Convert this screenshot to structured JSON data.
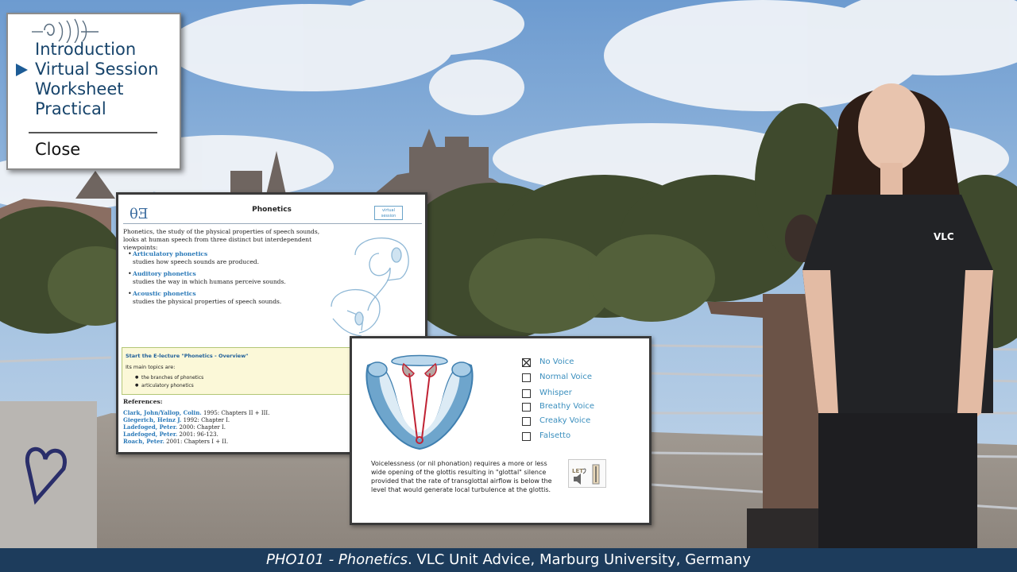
{
  "menu": {
    "items": [
      {
        "label": "Introduction",
        "active": false
      },
      {
        "label": "Virtual Session",
        "active": true
      },
      {
        "label": "Worksheet",
        "active": false
      },
      {
        "label": "Practical",
        "active": false
      }
    ],
    "close_label": "Close",
    "logo_icon": "sound-wave-logo-icon"
  },
  "doc": {
    "logo": "θƎ",
    "title": "Phonetics",
    "badge": "virtual session",
    "intro": "Phonetics, the study of the physical properties of speech sounds, looks at human speech from three distinct but interdependent viewpoints:",
    "branches": [
      {
        "name": "Articulatory phonetics",
        "desc": "studies how speech sounds are produced."
      },
      {
        "name": "Auditory phonetics",
        "desc": "studies the way in which humans perceive sounds."
      },
      {
        "name": "Acoustic phonetics",
        "desc": "studies the physical properties of speech sounds."
      }
    ],
    "lecture": {
      "title": "Start the E-lecture \"Phonetics - Overview\"",
      "subtitle": "Its main topics are:",
      "topics": [
        "the branches of phonetics",
        "articulatory phonetics"
      ]
    },
    "refs_title": "References:",
    "refs": [
      {
        "author": "Clark, John/Yallop, Colin.",
        "detail": " 1995: Chapters II + III."
      },
      {
        "author": "Giegerich, Heinz J.",
        "detail": " 1992: Chapter I."
      },
      {
        "author": "Ladefoged, Peter.",
        "detail": " 2000: Chapter I."
      },
      {
        "author": "Ladefoged, Peter.",
        "detail": " 2001: 96-123."
      },
      {
        "author": "Roach, Peter.",
        "detail": " 2001: Chapters I + II."
      }
    ],
    "figure_icon": "head-ear-anatomy-icon"
  },
  "phonation": {
    "options": [
      {
        "label": "No Voice",
        "checked": true
      },
      {
        "label": "Normal Voice",
        "checked": false
      },
      {
        "label": "Whisper",
        "checked": false
      },
      {
        "label": "Breathy Voice",
        "checked": false
      },
      {
        "label": "Creaky Voice",
        "checked": false
      },
      {
        "label": "Falsetto",
        "checked": false
      }
    ],
    "description": "Voicelessness (or nil phonation) requires a more or less wide opening of the glottis resulting in \"glottal\" silence provided that the rate of transglottal airflow is below the level that would generate local turbulence at the glottis.",
    "audio_label": "LET",
    "figure_icon": "glottis-diagram-icon"
  },
  "caption": {
    "course": "PHO101",
    "sep": " - ",
    "topic": "Phonetics",
    "rest": ". VLC Unit Advice, Marburg University, Germany"
  },
  "presenter": {
    "shirt_logo": "VLC"
  },
  "colors": {
    "nav_text": "#17446b",
    "link_blue": "#2a79b8",
    "option_blue": "#3b8fbe",
    "caption_bg": "#1d3c5c"
  }
}
